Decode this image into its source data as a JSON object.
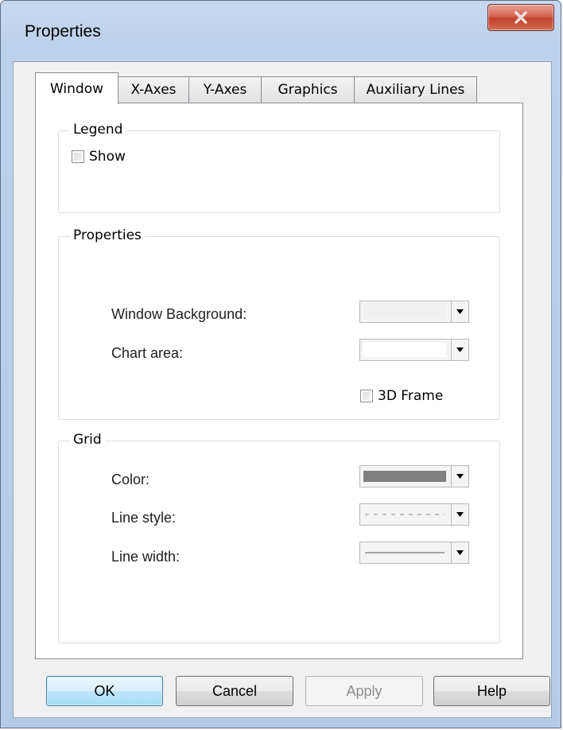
{
  "window": {
    "title": "Properties"
  },
  "tabs": [
    {
      "label": "Window",
      "active": true
    },
    {
      "label": "X-Axes",
      "active": false
    },
    {
      "label": "Y-Axes",
      "active": false
    },
    {
      "label": "Graphics",
      "active": false
    },
    {
      "label": "Auxiliary Lines",
      "active": false
    }
  ],
  "legend": {
    "group_label": "Legend",
    "show_label": "Show",
    "show_checked": false
  },
  "properties": {
    "group_label": "Properties",
    "window_background_label": "Window Background:",
    "window_background_color": "#f0f0f0",
    "chart_area_label": "Chart area:",
    "chart_area_color": "#ffffff",
    "frame3d_label": "3D Frame",
    "frame3d_checked": false
  },
  "grid": {
    "group_label": "Grid",
    "color_label": "Color:",
    "color_value": "#808080",
    "line_style_label": "Line style:",
    "line_style_value": "dashed",
    "line_width_label": "Line width:",
    "line_width_value": "thin"
  },
  "buttons": {
    "ok": "OK",
    "cancel": "Cancel",
    "apply": "Apply",
    "help": "Help"
  }
}
